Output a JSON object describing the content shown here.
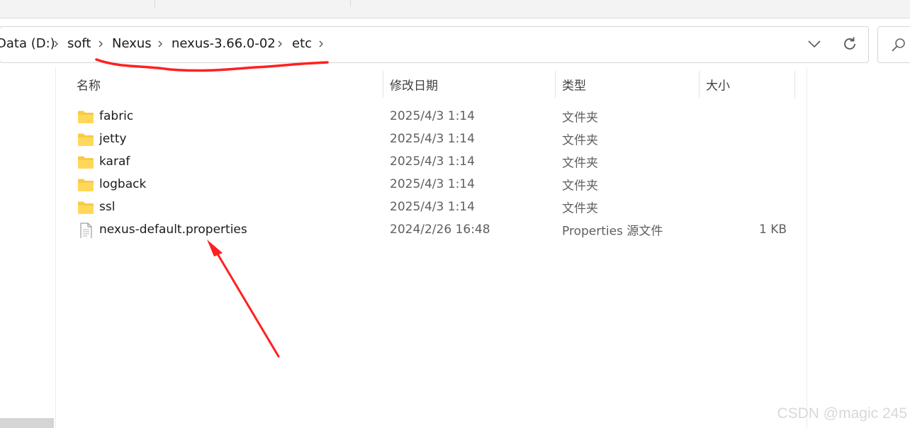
{
  "breadcrumb": {
    "items": [
      "Data (D:)",
      "soft",
      "Nexus",
      "nexus-3.66.0-02",
      "etc"
    ]
  },
  "columns": {
    "name": "名称",
    "date": "修改日期",
    "type": "类型",
    "size": "大小"
  },
  "files": [
    {
      "name": "fabric",
      "date": "2025/4/3 1:14",
      "type": "文件夹",
      "size": "",
      "icon": "folder-icon"
    },
    {
      "name": "jetty",
      "date": "2025/4/3 1:14",
      "type": "文件夹",
      "size": "",
      "icon": "folder-icon"
    },
    {
      "name": "karaf",
      "date": "2025/4/3 1:14",
      "type": "文件夹",
      "size": "",
      "icon": "folder-icon"
    },
    {
      "name": "logback",
      "date": "2025/4/3 1:14",
      "type": "文件夹",
      "size": "",
      "icon": "folder-icon"
    },
    {
      "name": "ssl",
      "date": "2025/4/3 1:14",
      "type": "文件夹",
      "size": "",
      "icon": "folder-icon"
    },
    {
      "name": "nexus-default.properties",
      "date": "2024/2/26 16:48",
      "type": "Properties 源文件",
      "size": "1 KB",
      "icon": "document-icon"
    }
  ],
  "watermark": "CSDN @magic 245",
  "colors": {
    "annotation": "#ff2020",
    "folder": "#f8c94a"
  }
}
